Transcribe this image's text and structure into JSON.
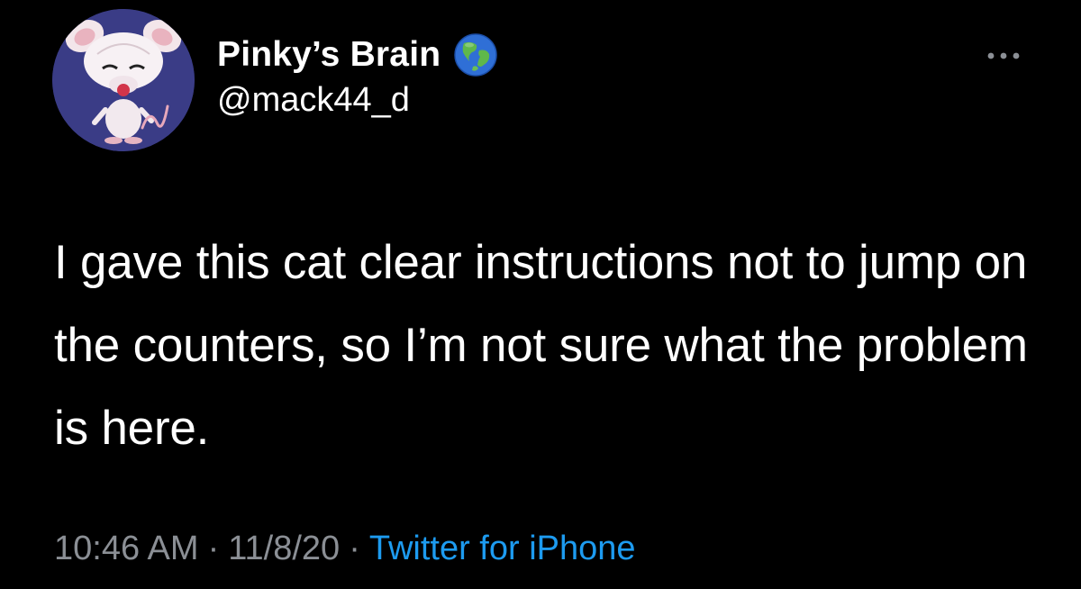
{
  "user": {
    "display_name": "Pinky’s Brain",
    "handle": "@mack44_d",
    "avatar_icon": "brain-mouse-avatar",
    "badge_icon": "globe-icon"
  },
  "tweet": {
    "text": "I gave this cat clear instructions not to jump on the counters, so I’m not sure what the problem is here."
  },
  "meta": {
    "time": "10:46 AM",
    "separator": "·",
    "date": "11/8/20",
    "source": "Twitter for iPhone"
  },
  "colors": {
    "background": "#000000",
    "text": "#ffffff",
    "muted": "#8b8f95",
    "link": "#1d9bf0",
    "avatar_bg": "#3a3c86"
  },
  "actions": {
    "more_icon": "more-options-icon"
  }
}
